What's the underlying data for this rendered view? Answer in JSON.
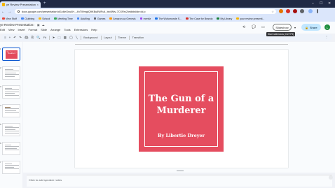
{
  "browser": {
    "tab_title": "ye Review Presentation - Go...",
    "tab_close": "×",
    "new_tab": "+",
    "window_controls": [
      "–",
      "☐",
      "✕"
    ],
    "nav": [
      "←",
      "→",
      "↻"
    ],
    "url": "docs.google.com/presentation/d/1c6eGnu4H_-4hTWmgIQ9KBu8WFu4_bb4Wtv-7CXRrc2/edit#slide=id.p",
    "star": "☆",
    "bookmarks": [
      {
        "label": "View Stuff",
        "color": "#ea4335"
      },
      {
        "label": "Clubbing",
        "color": "#4285f4"
      },
      {
        "label": "School",
        "color": "#fbbc04"
      },
      {
        "label": "Meeting Time",
        "color": "#34a853"
      },
      {
        "label": "Adulting",
        "color": "#4285f4"
      },
      {
        "label": "Games",
        "color": "#5f6368"
      },
      {
        "label": "Amazon.ca Genesis",
        "color": "#ff9900"
      },
      {
        "label": "mentlz",
        "color": "#a142f4"
      },
      {
        "label": "The Wufumonde S...",
        "color": "#1a73e8"
      },
      {
        "label": "The Case for Brando",
        "color": "#d93025"
      },
      {
        "label": "My Library",
        "color": "#188038"
      },
      {
        "label": "your review presenti...",
        "color": "#f4b400"
      }
    ]
  },
  "app": {
    "doc_title": "ye Review Presentation",
    "title_icons": "☆ ▣ ☁",
    "menu": [
      "Edit",
      "View",
      "Insert",
      "Format",
      "Slide",
      "Arrange",
      "Tools",
      "Extensions",
      "Help"
    ],
    "slideshow_label": "Slideshow",
    "slideshow_dropdown": "▾",
    "share_label": "Share",
    "share_icon": "🔒",
    "avatar_initial": "L",
    "tooltip": "Start slideshow (Ctrl+F5)",
    "header_icons": [
      "⟲",
      "💬",
      "▭"
    ]
  },
  "toolbar": {
    "icons_left": [
      "≡",
      "+",
      "↶",
      "↷",
      "🖨",
      "⎘",
      "🔍",
      "Fit"
    ],
    "icons_mid": [
      "➤",
      "⬚",
      "▦",
      "◯",
      "╲"
    ],
    "background_label": "Background",
    "layout_label": "Layout",
    "theme_label": "Theme",
    "transition_label": "Transition",
    "right": "⋮"
  },
  "filmstrip": {
    "slides": [
      1,
      2,
      3,
      4,
      5,
      6,
      7
    ]
  },
  "slide": {
    "book_title": "The Gun of a Murderer",
    "book_author": "By Libertie Dreyer"
  },
  "notes": {
    "placeholder": "Click to add speaker notes"
  }
}
